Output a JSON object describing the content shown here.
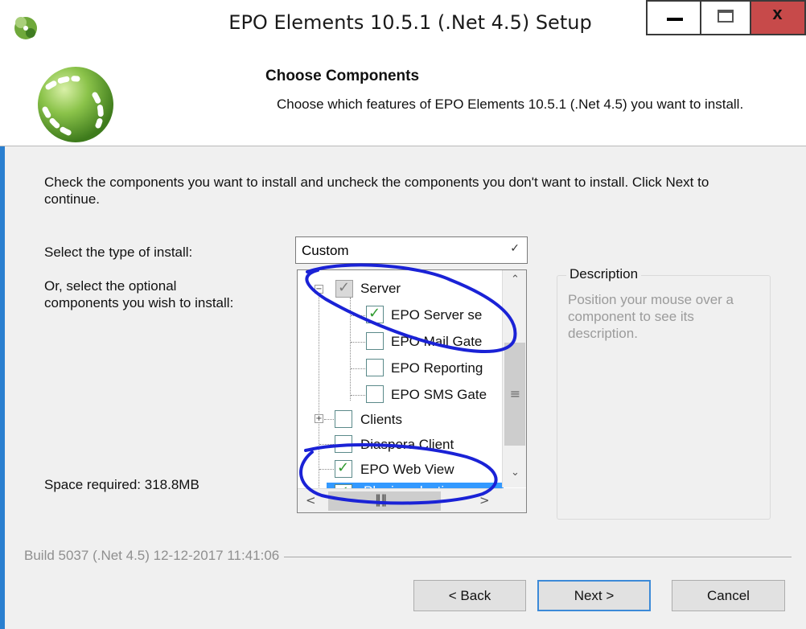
{
  "window": {
    "title": "EPO Elements 10.5.1 (.Net 4.5) Setup",
    "close_glyph": "x"
  },
  "header": {
    "title": "Choose Components",
    "subtitle": "Choose which features of EPO Elements 10.5.1 (.Net 4.5) you want to install."
  },
  "body": {
    "instructions": "Check the components you want to install and uncheck the components you don't want to install. Click Next to continue.",
    "install_type_label": "Select the type of install:",
    "optional_label": "Or, select the optional components you wish to install:",
    "space_required": "Space required: 318.8MB"
  },
  "install_type": {
    "selected": "Custom"
  },
  "components": [
    {
      "label": "Server",
      "checked": "partial",
      "expander": "−"
    },
    {
      "label": "EPO Server se",
      "checked": true
    },
    {
      "label": "EPO Mail Gate",
      "checked": false
    },
    {
      "label": "EPO Reporting",
      "checked": false
    },
    {
      "label": "EPO SMS Gate",
      "checked": false
    },
    {
      "label": "Clients",
      "checked": false,
      "expander": "+"
    },
    {
      "label": "Diaspora Client",
      "checked": false
    },
    {
      "label": "EPO Web View",
      "checked": true
    },
    {
      "label": "Plugin selection",
      "checked": true,
      "selected": true
    }
  ],
  "description": {
    "title": "Description",
    "text": "Position your mouse over a component to see its description."
  },
  "footer": {
    "build": "Build 5037 (.Net 4.5)   12-12-2017 11:41:06",
    "back": "< Back",
    "next": "Next >",
    "cancel": "Cancel"
  },
  "colors": {
    "accent": "#2a7fd0",
    "close_button": "#c74a4a",
    "selection": "#3399ff",
    "checkmark": "#2e9a2e",
    "annotation": "#1a22d6"
  }
}
